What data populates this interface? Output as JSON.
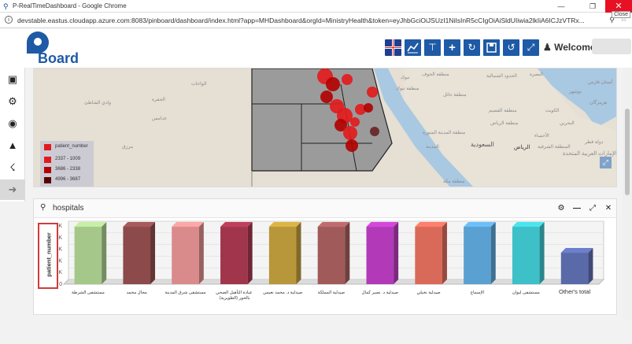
{
  "browser": {
    "title": "P-RealTimeDashboard - Google Chrome",
    "url": "devstable.eastus.cloudapp.azure.com:8083/pinboard/dashboard/index.html?app=MHDashboard&orgId=MinistryHealth&token=eyJhbGciOiJSUzI1NiIsInR5cCIgOiAiSldUIiwia2lkIiA6ICJzVTRx...",
    "close_tooltip": "Close"
  },
  "header": {
    "logo_text": "Board",
    "welcome": "Welcome,"
  },
  "toolbar": {
    "icons": [
      "uk-flag-icon",
      "line-chart-icon",
      "text-icon",
      "plus-icon",
      "refresh-icon",
      "save-icon",
      "undo-icon",
      "fullscreen-icon"
    ]
  },
  "map": {
    "legend": {
      "title": "patient_number",
      "items": [
        {
          "label": "2337 - 1009",
          "color": "#e31a1c"
        },
        {
          "label": "3686 - 2338",
          "color": "#b30000"
        },
        {
          "label": "4996 - 3687",
          "color": "#5a0000"
        }
      ]
    },
    "labels": [
      "الواحات",
      "وادي الشاطئ",
      "الجفرة",
      "غدامس",
      "مرزق",
      "تبوك",
      "منطقة تبوك",
      "منطقة الجوف",
      "الحدود الشمالية",
      "منطقة حائل",
      "منطقة القصيم",
      "منطقة المدينة المنورة",
      "المدينة",
      "منطقة الرياض",
      "الرياض",
      "السعودية",
      "الأحساء",
      "المنطقة الشرقية",
      "منطقة مكة",
      "البحرين",
      "دولة قطر",
      "بوشهر",
      "البصرة",
      "الكويت",
      "الإمارات العربية المتحدة",
      "أستان فارس",
      "هرمزگان"
    ]
  },
  "hospitals": {
    "title": "hospitals"
  },
  "chart_data": {
    "type": "bar",
    "title": "",
    "xlabel": "",
    "ylabel": "patient_number",
    "ylim": [
      0,
      5000
    ],
    "yticks": [
      "0",
      "1K",
      "2K",
      "3K",
      "4K",
      "5K"
    ],
    "categories": [
      "مستشفى الشرطة",
      "مجال محمد",
      "مستشفى شرق المدينة",
      "عيادة التأهيل الصحي بالحور (الطويرية)",
      "صيدلية د. محمد نعيمي",
      "صيدلية المملكة",
      "صيدلية د. نصير كمال",
      "صيدلية نخيلي",
      "الإسماع",
      "مستشفى ليوان",
      "Other's total"
    ],
    "values": [
      4930,
      4930,
      4930,
      4930,
      4930,
      4930,
      4930,
      4930,
      4930,
      4930,
      2700
    ],
    "colors": [
      "#a5c88a",
      "#8c4a4a",
      "#d98a8a",
      "#a0354c",
      "#b8963a",
      "#a05a5a",
      "#b23ab8",
      "#d96a5a",
      "#5aa0d0",
      "#3ec0c8",
      "#5a6aa8"
    ]
  }
}
